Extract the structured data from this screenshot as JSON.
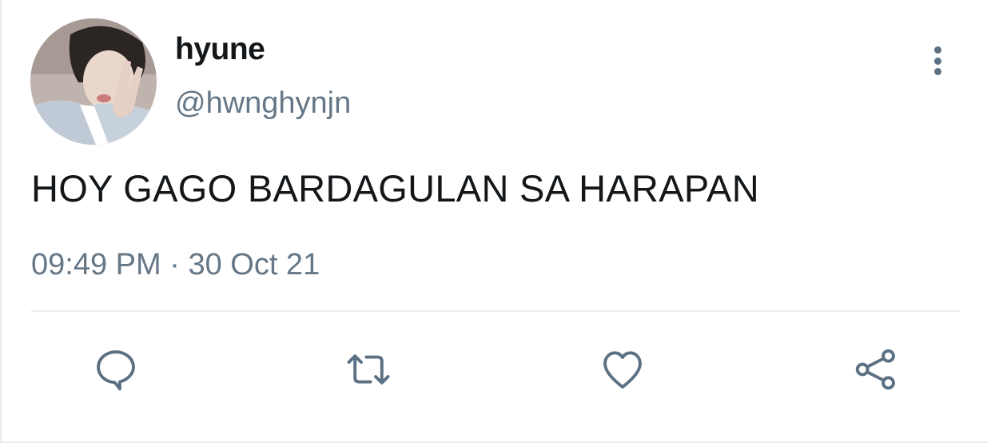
{
  "tweet": {
    "display_name": "hyune",
    "handle": "@hwnghynjn",
    "text": "HOY GAGO BARDAGULAN SA HARAPAN",
    "time": "09:49 PM",
    "separator": "·",
    "date": "30 Oct 21"
  },
  "icons": {
    "more": "more-vertical-icon",
    "reply": "reply-icon",
    "retweet": "retweet-icon",
    "like": "heart-icon",
    "share": "share-icon"
  },
  "colors": {
    "text": "#14171a",
    "secondary": "#657786",
    "icon": "#5b7083",
    "divider": "#e6ecf0"
  }
}
